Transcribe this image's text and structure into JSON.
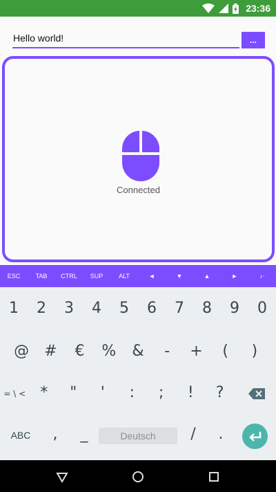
{
  "status_bar": {
    "time": "23:36",
    "background": "#3f9c3a",
    "icons": [
      "wifi-icon",
      "signal-icon",
      "battery-charging-icon"
    ]
  },
  "input": {
    "value": "Hello world!",
    "more_button_label": "..."
  },
  "touchpad": {
    "status_text": "Connected",
    "accent": "#7c4dff",
    "icon": "mouse-icon"
  },
  "special_keys": [
    "ESC",
    "TAB",
    "CTRL",
    "SUP",
    "ALT",
    "◄",
    "▼",
    "▲",
    "►",
    "♪·"
  ],
  "keyboard": {
    "row1": [
      "1",
      "2",
      "3",
      "4",
      "5",
      "6",
      "7",
      "8",
      "9",
      "0"
    ],
    "row2": [
      "@",
      "#",
      "€",
      "%",
      "&",
      "-",
      "+",
      "(",
      ")"
    ],
    "row3": [
      "= \\ <",
      "*",
      "\"",
      "'",
      ":",
      ";",
      "!",
      "?"
    ],
    "row4": {
      "abc": "ABC",
      "comma": ",",
      "underscore": "_",
      "space": "Deutsch",
      "slash": "/",
      "period": "."
    },
    "enter_color": "#4db6ac"
  },
  "nav_bar": {
    "buttons": [
      "back-icon",
      "home-icon",
      "recents-icon"
    ]
  }
}
